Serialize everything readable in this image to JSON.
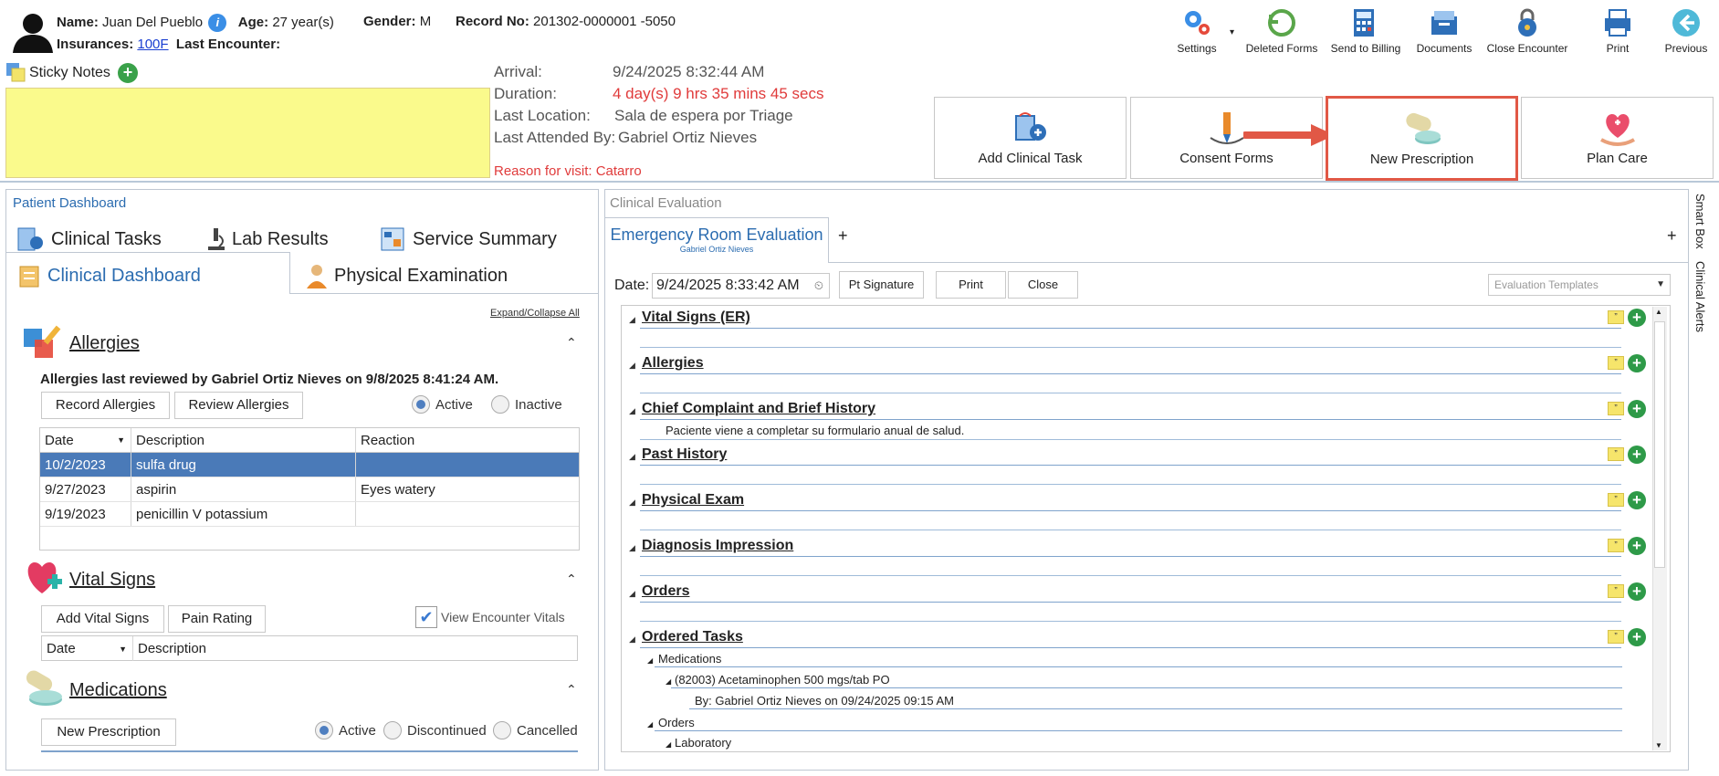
{
  "patient": {
    "name_label": "Name:",
    "name": "Juan Del Pueblo",
    "age_label": "Age:",
    "age": "27 year(s)",
    "gender_label": "Gender:",
    "gender": "M",
    "record_label": "Record No:",
    "record": "201302-0000001 -5050",
    "insurances_label": "Insurances:",
    "insurance": "100F",
    "last_encounter_label": "Last Encounter:"
  },
  "toolbar": [
    {
      "label": "Settings"
    },
    {
      "label": "Deleted Forms"
    },
    {
      "label": "Send to Billing"
    },
    {
      "label": "Documents"
    },
    {
      "label": "Close Encounter"
    },
    {
      "label": "Print"
    },
    {
      "label": "Previous"
    }
  ],
  "sticky": {
    "label": "Sticky Notes"
  },
  "encounter": {
    "arrival_label": "Arrival:",
    "arrival": "9/24/2025 8:32:44 AM",
    "duration_label": "Duration:",
    "duration": "4 day(s) 9 hrs 35 mins 45 secs",
    "location_label": "Last Location:",
    "location": "Sala de espera por Triage",
    "attended_label": "Last Attended By:",
    "attended": "Gabriel Ortiz Nieves",
    "reason": "Reason for visit: Catarro"
  },
  "actions": [
    {
      "label": "Add Clinical Task"
    },
    {
      "label": "Consent Forms"
    },
    {
      "label": "New Prescription"
    },
    {
      "label": "Plan Care"
    }
  ],
  "left": {
    "caption": "Patient Dashboard",
    "tabs": [
      "Clinical Tasks",
      "Lab Results",
      "Service Summary",
      "Clinical Dashboard",
      "Physical Examination"
    ],
    "expand": "Expand/Collapse All",
    "allergies": {
      "title": "Allergies",
      "reviewed": "Allergies last reviewed by Gabriel Ortiz Nieves on 9/8/2025 8:41:24 AM.",
      "record_btn": "Record Allergies",
      "review_btn": "Review Allergies",
      "active": "Active",
      "inactive": "Inactive",
      "headers": [
        "Date",
        "Description",
        "Reaction"
      ],
      "rows": [
        [
          "10/2/2023",
          "sulfa drug",
          ""
        ],
        [
          "9/27/2023",
          "aspirin",
          "Eyes watery"
        ],
        [
          "9/19/2023",
          "penicillin V potassium",
          ""
        ]
      ]
    },
    "vitals": {
      "title": "Vital Signs",
      "add_btn": "Add Vital Signs",
      "pain_btn": "Pain Rating",
      "view_check": "View Encounter Vitals",
      "headers": [
        "Date",
        "Description"
      ]
    },
    "medications": {
      "title": "Medications",
      "new_btn": "New Prescription",
      "active": "Active",
      "discontinued": "Discontinued",
      "cancelled": "Cancelled"
    }
  },
  "right": {
    "caption": "Clinical Evaluation",
    "tab_title": "Emergency Room Evaluation",
    "tab_sub": "Gabriel Ortiz Nieves",
    "plus": "+",
    "date_label": "Date:",
    "date_value": "9/24/2025 8:33:42 AM",
    "pt_signature": "Pt Signature",
    "print": "Print",
    "close": "Close",
    "templates": "Evaluation Templates",
    "sections": [
      "Vital Signs (ER)",
      "Allergies",
      "Chief Complaint and Brief History",
      "Past History",
      "Physical Exam",
      "Diagnosis Impression",
      "Orders",
      "Ordered Tasks"
    ],
    "chief_text": "Paciente viene a completar su formulario anual de salud.",
    "tasks": {
      "medications": "Medications",
      "med_item": "(82003) Acetaminophen 500 mgs/tab PO",
      "med_by": "By: Gabriel Ortiz Nieves on 09/24/2025 09:15 AM",
      "orders": "Orders",
      "lab": "Laboratory"
    }
  },
  "side": {
    "smart_box": "Smart Box",
    "clinical_alerts": "Clinical Alerts"
  },
  "colors": {
    "accent": "#2b6cb0",
    "highlight": "#e15846",
    "sticky": "#fafa8c",
    "selected_row": "#4a7ab8"
  }
}
